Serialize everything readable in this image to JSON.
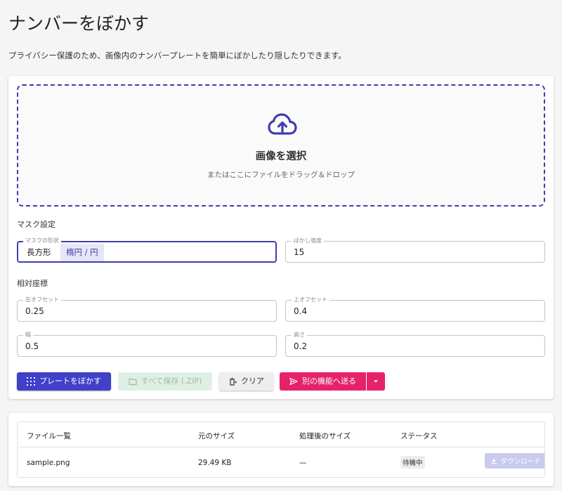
{
  "header": {
    "title": "ナンバーをぼかす",
    "description": "プライバシー保護のため、画像内のナンバープレートを簡単にぼかしたり隠したりできます。"
  },
  "dropzone": {
    "title": "画像を選択",
    "subtitle": "またはここにファイルをドラッグ＆ドロップ",
    "icon": "cloud-upload-icon",
    "accent": "#3f3faa"
  },
  "mask_settings": {
    "section_label": "マスク設定",
    "shape_label": "マスクの形状",
    "shape_options": [
      "長方形",
      "楕円 / 円"
    ],
    "shape_selected": "楕円 / 円",
    "blur_label": "ぼかし強度",
    "blur_value": "15"
  },
  "relative_coords": {
    "section_label": "相対座標",
    "left_offset_label": "左オフセット",
    "left_offset_value": "0.25",
    "top_offset_label": "上オフセット",
    "top_offset_value": "0.4",
    "width_label": "幅",
    "width_value": "0.5",
    "height_label": "高さ",
    "height_value": "0.2"
  },
  "actions": {
    "blur_plate": "プレートをぼかす",
    "save_all_zip": "すべて保存 (.ZIP)",
    "clear": "クリア",
    "send_to_other": "別の機能へ送る",
    "primary_color": "#4040c8",
    "send_color": "#e6226a"
  },
  "file_table": {
    "columns": [
      "ファイル一覧",
      "元のサイズ",
      "処理後のサイズ",
      "ステータス"
    ],
    "rows": [
      {
        "name": "sample.png",
        "original_size": "29.49 KB",
        "processed_size": "—",
        "status": "待機中",
        "action": "ダウンロード"
      }
    ]
  }
}
